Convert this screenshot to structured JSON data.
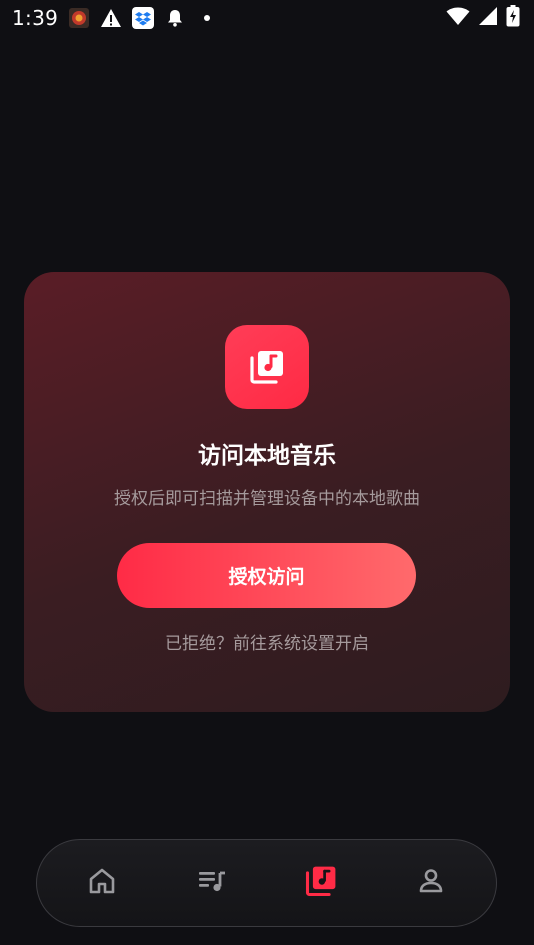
{
  "status_bar": {
    "time": "1:39",
    "notification_icons": [
      "app-notification-icon",
      "warning-icon",
      "dropbox-icon",
      "bell-icon",
      "dot-icon"
    ],
    "system_icons": [
      "wifi-icon",
      "signal-icon",
      "battery-charging-icon"
    ]
  },
  "permission_card": {
    "icon": "music-library-icon",
    "title": "访问本地音乐",
    "description": "授权后即可扫描并管理设备中的本地歌曲",
    "button_label": "授权访问",
    "settings_link": "已拒绝？前往系统设置开启"
  },
  "bottom_nav": {
    "items": [
      {
        "icon": "home-icon",
        "active": false
      },
      {
        "icon": "playlist-icon",
        "active": false
      },
      {
        "icon": "music-library-icon",
        "active": true
      },
      {
        "icon": "profile-icon",
        "active": false
      }
    ]
  },
  "colors": {
    "background": "#0f0f13",
    "accent": "#ff2b46",
    "accent_gradient_end": "#ff6a6c",
    "muted_text": "#a59a9c",
    "nav_icon_inactive": "#9a9a9e"
  }
}
